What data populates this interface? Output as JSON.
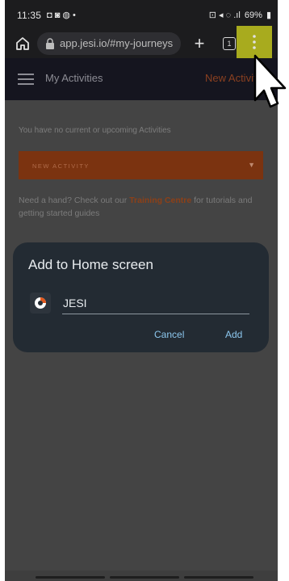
{
  "status_bar": {
    "time": "11:35",
    "left_icons": "◘ ◙ ◍ •",
    "right_icons": "⊡ ◂ ◌ .ıl",
    "battery": "69%"
  },
  "browser": {
    "url": "app.jesi.io/#my-journeys",
    "tab_count": "1",
    "highlight_color": "#a8ab1e"
  },
  "app_header": {
    "title": "My Activities",
    "action": "New Activity"
  },
  "content": {
    "no_activities_text": "You have no current or upcoming Activities",
    "new_activity_label": "NEW ACTIVITY",
    "help_prefix": "Need a hand? Check out our ",
    "help_link": "Training Centre",
    "help_suffix": " for tutorials and getting started guides"
  },
  "dialog": {
    "title": "Add to Home screen",
    "name_value": "JESI",
    "cancel_label": "Cancel",
    "add_label": "Add"
  },
  "colors": {
    "accent": "#8cc7ee",
    "brand": "#7b3310"
  },
  "icons": {
    "home": "home-icon",
    "lock": "lock-icon",
    "plus": "plus-icon",
    "tabs": "tabs-icon",
    "menu": "more-vert-icon",
    "hamburger": "hamburger-icon",
    "app": "jesi-app-icon",
    "cursor": "cursor-arrow-icon"
  }
}
